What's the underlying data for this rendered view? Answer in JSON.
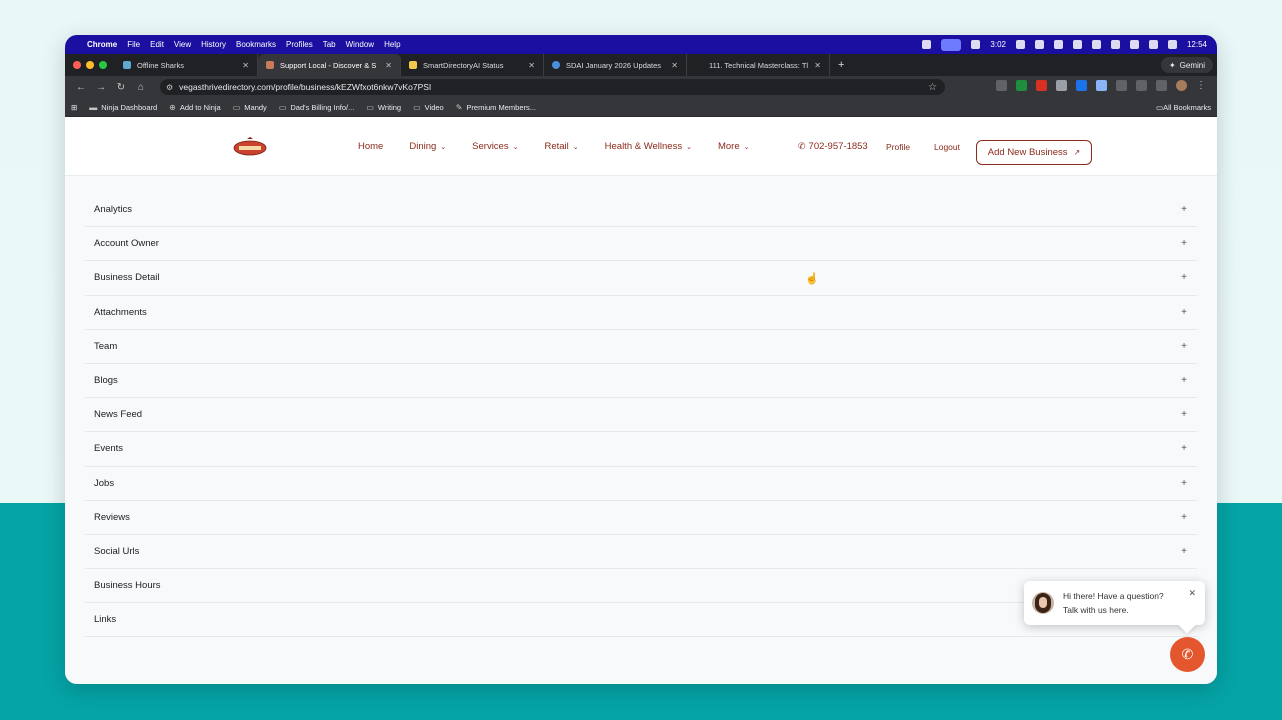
{
  "menubar": {
    "app_name": "Chrome",
    "menus": [
      "File",
      "Edit",
      "View",
      "History",
      "Bookmarks",
      "Profiles",
      "Tab",
      "Window",
      "Help"
    ],
    "timer": "3:02",
    "clock": "12:54"
  },
  "tabs": [
    {
      "label": "Offline Sharks",
      "favicon_color": "#5fa8d3",
      "active": false
    },
    {
      "label": "Support Local - Discover & S",
      "favicon_color": "#c97b5a",
      "active": true
    },
    {
      "label": "SmartDirectoryAI Status",
      "favicon_color": "#f2c94c",
      "active": false
    },
    {
      "label": "SDAI January 2026 Updates",
      "favicon_color": "#4a90d9",
      "active": false
    },
    {
      "label": "111. Technical Masterclass: Tl",
      "favicon_color": "#222222",
      "active": false
    }
  ],
  "gemini_label": "Gemini",
  "address": {
    "url": "vegasthrivedirectory.com/profile/business/kEZWfxot6nkw7vKo7PSI"
  },
  "bookmarks": [
    {
      "label": "Ninja Dashboard",
      "icon": "ninja-icon"
    },
    {
      "label": "Add to Ninja",
      "icon": "globe-icon"
    },
    {
      "label": "Mandy",
      "icon": "folder-icon"
    },
    {
      "label": "Dad's Billing Info/...",
      "icon": "folder-icon"
    },
    {
      "label": "Writing",
      "icon": "folder-icon"
    },
    {
      "label": "Video",
      "icon": "folder-icon"
    },
    {
      "label": "Premium Members...",
      "icon": "puzzle-icon"
    }
  ],
  "all_bookmarks_label": "All Bookmarks",
  "site_nav": {
    "links": [
      {
        "label": "Home",
        "has_dropdown": false
      },
      {
        "label": "Dining",
        "has_dropdown": true
      },
      {
        "label": "Services",
        "has_dropdown": true
      },
      {
        "label": "Retail",
        "has_dropdown": true
      },
      {
        "label": "Health & Wellness",
        "has_dropdown": true
      },
      {
        "label": "More",
        "has_dropdown": true
      }
    ],
    "phone": "702-957-1853",
    "profile_label": "Profile",
    "logout_label": "Logout",
    "add_business_label": "Add New Business",
    "accent_color": "#8a2a1c"
  },
  "accordion": {
    "sections": [
      "Analytics",
      "Account Owner",
      "Business Detail",
      "Attachments",
      "Team",
      "Blogs",
      "News Feed",
      "Events",
      "Jobs",
      "Reviews",
      "Social Urls",
      "Business Hours",
      "Links"
    ],
    "expand_symbol": "+"
  },
  "chat": {
    "line1": "Hi there! Have a question?",
    "line2": "Talk with us here.",
    "button_color": "#e4572e"
  }
}
